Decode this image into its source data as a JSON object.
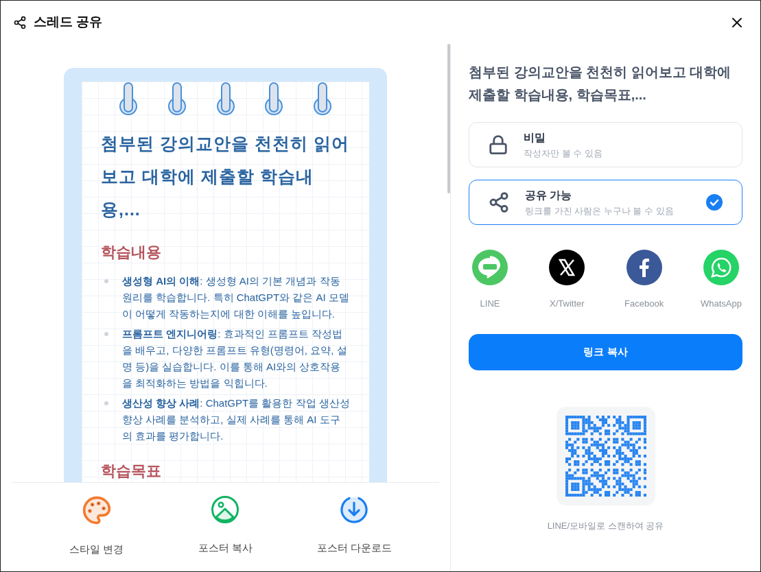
{
  "dialog": {
    "title": "스레드 공유"
  },
  "poster": {
    "title": "첨부된 강의교안을 천천히 읽어보고 대학에 제출할 학습내용,...",
    "sections": [
      {
        "heading": "학습내용",
        "items": [
          "**생성형 AI의 이해**: 생성형 AI의 기본 개념과 작동 원리를 학습합니다. 특히 ChatGPT와 같은 AI 모델이 어떻게 작동하는지에 대한 이해를 높입니다.",
          "**프롬프트 엔지니어링**: 효과적인 프롬프트 작성법을 배우고, 다양한 프롬프트 유형(명령어, 요약, 설명 등)을 실습합니다. 이를 통해 AI와의 상호작용을 최적화하는 방법을 익힙니다.",
          "**생산성 향상 사례**: ChatGPT를 활용한 작업 생산성 향상 사례를 분석하고, 실제 사례를 통해 AI 도구의 효과를 평가합니다."
        ]
      },
      {
        "heading": "학습목표"
      }
    ]
  },
  "actions": [
    {
      "label": "스타일 변경",
      "kind": "palette"
    },
    {
      "label": "포스터 복사",
      "kind": "image"
    },
    {
      "label": "포스터 다운로드",
      "kind": "download"
    }
  ],
  "share": {
    "title": "첨부된 강의교안을 천천히 읽어보고 대학에 제출할 학습내용, 학습목표,...",
    "visibility": [
      {
        "label": "비밀",
        "description": "작성자만 볼 수 있음",
        "kind": "lock",
        "selected": false
      },
      {
        "label": "공유 가능",
        "description": "링크를 가진 사람은 누구나 볼 수 있음",
        "kind": "share",
        "selected": true
      }
    ],
    "apps": [
      {
        "label": "LINE",
        "kind": "line"
      },
      {
        "label": "X/Twitter",
        "kind": "x"
      },
      {
        "label": "Facebook",
        "kind": "facebook"
      },
      {
        "label": "WhatsApp",
        "kind": "whatsapp"
      }
    ],
    "copy_button": "링크 복사",
    "qr_caption": "LINE/모바일로 스캔하여 공유"
  }
}
